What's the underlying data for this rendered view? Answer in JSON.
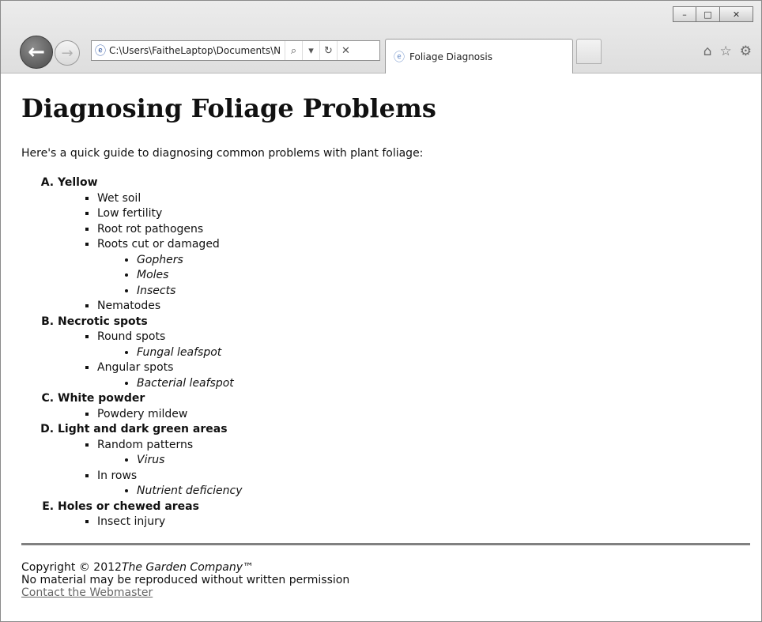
{
  "window": {
    "buttons": [
      "–",
      "□",
      "✕"
    ]
  },
  "toolbar": {
    "back_glyph": "←",
    "forward_glyph": "→",
    "address": "C:\\Users\\FaitheLaptop\\Documents\\N",
    "search_glyph": "⌕",
    "dropdown_glyph": "▾",
    "refresh_glyph": "↻",
    "stop_glyph": "✕",
    "tab_title": "Foliage Diagnosis",
    "home_glyph": "⌂",
    "favorites_glyph": "☆",
    "tools_glyph": "⚙"
  },
  "page": {
    "title": "Diagnosing Foliage Problems",
    "intro": "Here's a quick guide to diagnosing common problems with plant foliage:",
    "sections": [
      {
        "heading": "Yellow",
        "items": [
          {
            "label": "Wet soil",
            "subs": []
          },
          {
            "label": "Low fertility",
            "subs": []
          },
          {
            "label": "Root rot pathogens",
            "subs": []
          },
          {
            "label": "Roots cut or damaged",
            "subs": [
              "Gophers",
              "Moles",
              "Insects"
            ]
          },
          {
            "label": "Nematodes",
            "subs": []
          }
        ]
      },
      {
        "heading": "Necrotic spots",
        "items": [
          {
            "label": "Round spots",
            "subs": [
              "Fungal leafspot"
            ]
          },
          {
            "label": "Angular spots",
            "subs": [
              "Bacterial leafspot"
            ]
          }
        ]
      },
      {
        "heading": "White powder",
        "items": [
          {
            "label": "Powdery mildew",
            "subs": []
          }
        ]
      },
      {
        "heading": "Light and dark green areas",
        "items": [
          {
            "label": "Random patterns",
            "subs": [
              "Virus"
            ]
          },
          {
            "label": "In rows",
            "subs": [
              "Nutrient deficiency"
            ]
          }
        ]
      },
      {
        "heading": "Holes or chewed areas",
        "items": [
          {
            "label": "Insect injury",
            "subs": []
          }
        ]
      }
    ]
  },
  "footer": {
    "copyright_prefix": "Copyright © 2012",
    "company": "The Garden Company™",
    "notice": "No material may be reproduced without written permission",
    "contact_link": "Contact the Webmaster"
  }
}
